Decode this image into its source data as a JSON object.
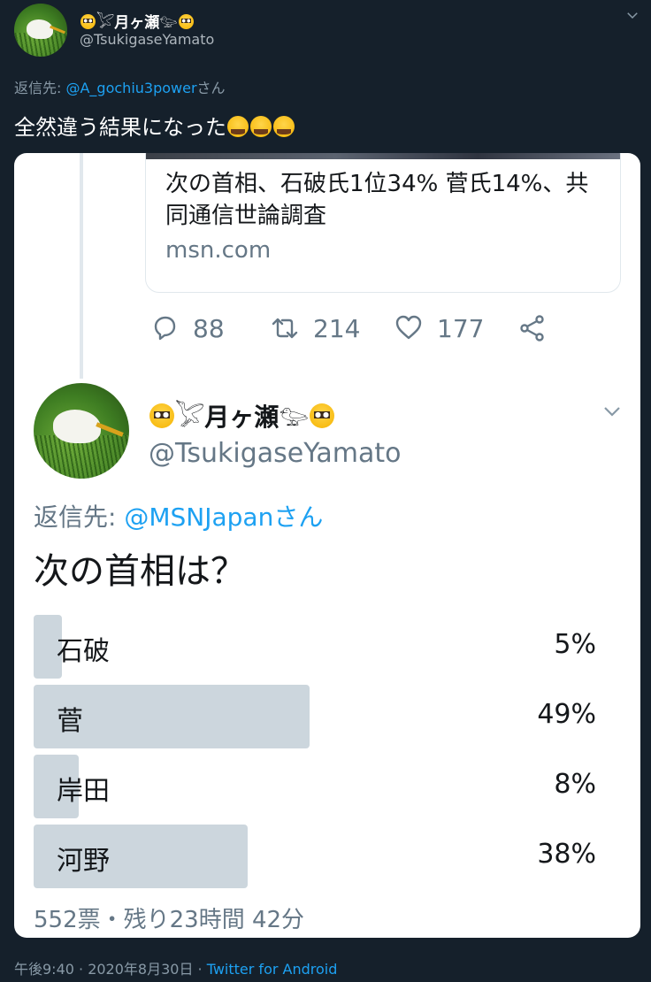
{
  "outer_tweet": {
    "display_name": "月ヶ瀬",
    "handle": "@TsukigaseYamato",
    "reply_prefix": "返信先: ",
    "reply_mention": "@A_gochiu3power",
    "reply_suffix": "さん",
    "text": "全然違う結果になった"
  },
  "embedded": {
    "link_card": {
      "title": "次の首相、石破氏1位34% 菅氏14%、共同通信世論調査",
      "domain": "msn.com"
    },
    "actions": {
      "replies": "88",
      "retweets": "214",
      "likes": "177"
    },
    "reply_tweet": {
      "display_name": "月ヶ瀬",
      "handle": "@TsukigaseYamato",
      "reply_prefix": "返信先: ",
      "reply_mention": "@MSNJapanさん",
      "question": "次の首相は？"
    },
    "poll": {
      "options": [
        {
          "label": "石破",
          "percent": "5%",
          "fraction": 0.05
        },
        {
          "label": "菅",
          "percent": "49%",
          "fraction": 0.49
        },
        {
          "label": "岸田",
          "percent": "8%",
          "fraction": 0.08
        },
        {
          "label": "河野",
          "percent": "38%",
          "fraction": 0.38
        }
      ],
      "footer": "552票・残り23時間 42分"
    }
  },
  "meta": {
    "timestamp": "午後9:40 · 2020年8月30日 · ",
    "source": "Twitter for Android"
  },
  "colors": {
    "background": "#15202b",
    "link": "#1da1f2",
    "poll_bar": "#ccd6dd",
    "muted": "#657786"
  }
}
